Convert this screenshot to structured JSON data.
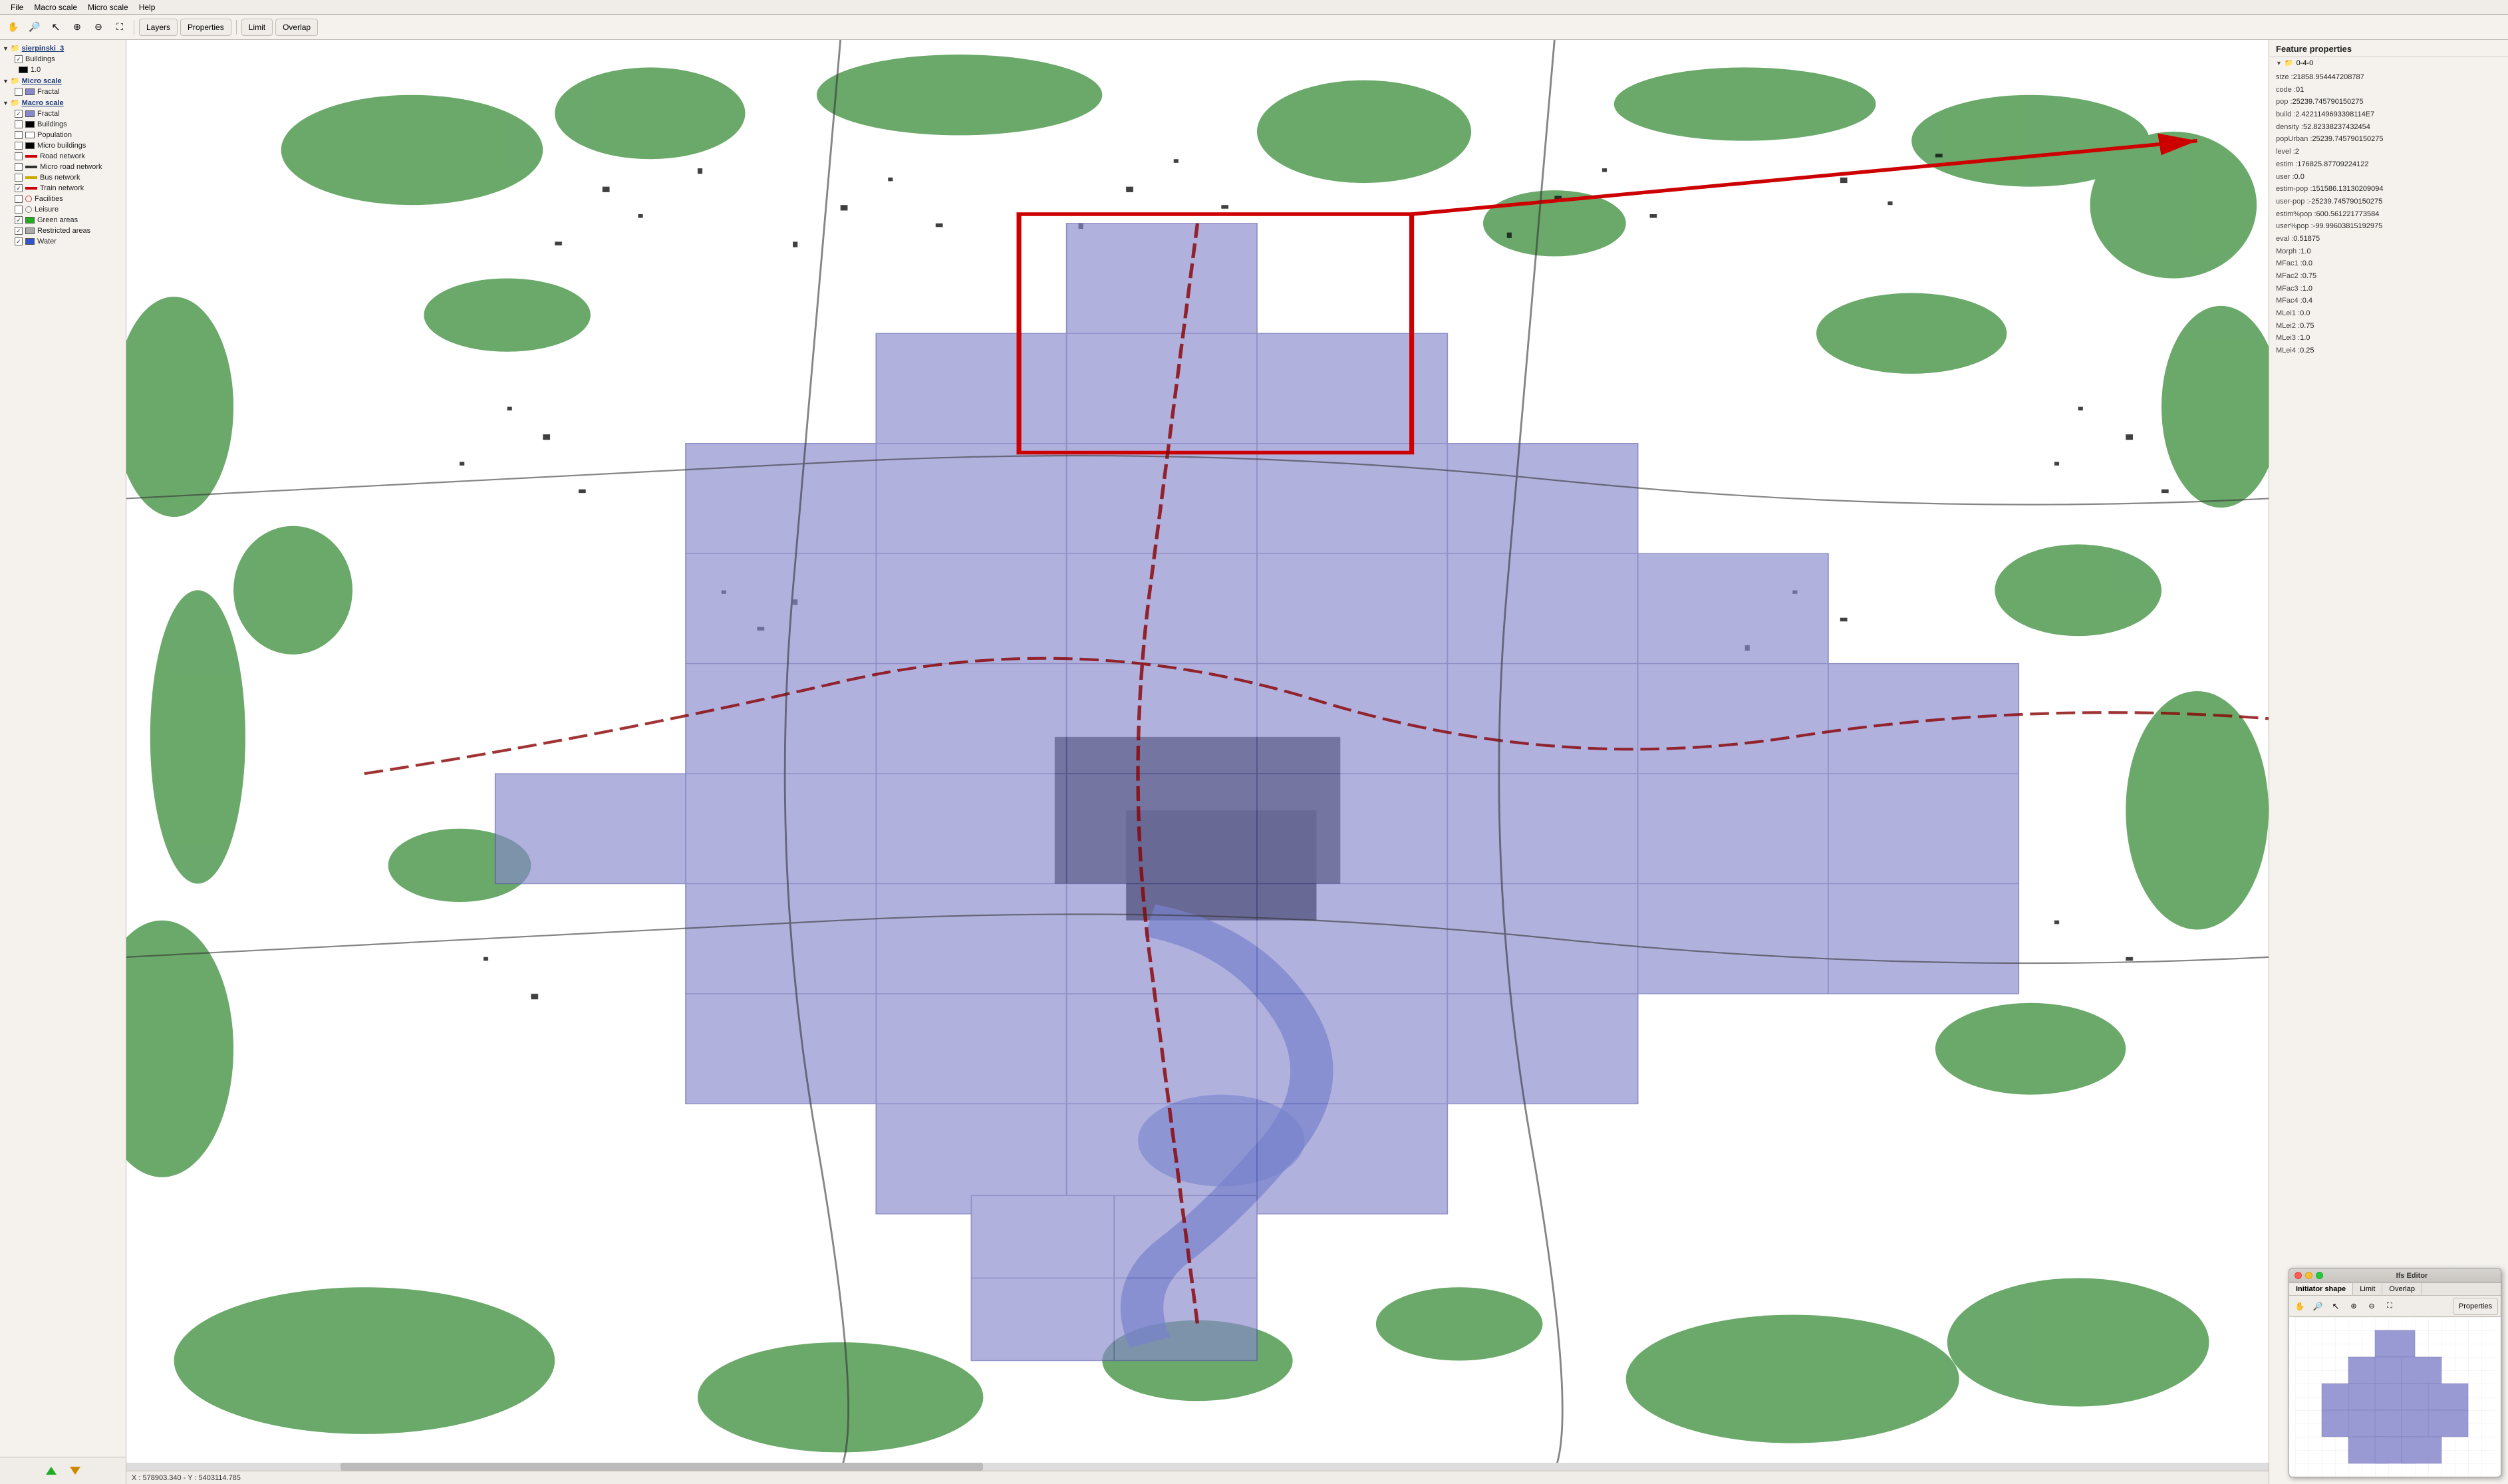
{
  "menubar": {
    "items": [
      "File",
      "Macro scale",
      "Micro scale",
      "Help"
    ]
  },
  "toolbar": {
    "buttons": [
      {
        "name": "hand-tool",
        "icon": "✋",
        "tooltip": "Pan"
      },
      {
        "name": "zoom-in",
        "icon": "🔍",
        "tooltip": "Zoom in"
      },
      {
        "name": "select",
        "icon": "↖",
        "tooltip": "Select"
      },
      {
        "name": "measure1",
        "icon": "⊕",
        "tooltip": "Measure 1"
      },
      {
        "name": "measure2",
        "icon": "⊖",
        "tooltip": "Measure 2"
      },
      {
        "name": "fullscreen",
        "icon": "⛶",
        "tooltip": "Fullscreen"
      }
    ],
    "text_buttons": [
      "Layers",
      "Properties",
      "Limit",
      "Overlap"
    ]
  },
  "sidebar": {
    "groups": [
      {
        "name": "sierpinski_3",
        "type": "root",
        "expanded": true,
        "items": [
          {
            "label": "Buildings",
            "checked": true,
            "swatch": "black",
            "swatch_value": "1.0"
          }
        ]
      },
      {
        "name": "Micro scale",
        "type": "group",
        "expanded": true,
        "items": [
          {
            "label": "Fractal",
            "checked": false,
            "color": "#8888cc"
          }
        ]
      },
      {
        "name": "Macro scale",
        "type": "group",
        "expanded": true,
        "items": [
          {
            "label": "Fractal",
            "checked": true,
            "color": "#8888cc"
          },
          {
            "label": "Buildings",
            "checked": false,
            "color": "#000000"
          },
          {
            "label": "Population",
            "checked": false,
            "color": "#ffffff"
          },
          {
            "label": "Micro buildings",
            "checked": false,
            "color": "#000000"
          },
          {
            "label": "Road network",
            "checked": false,
            "color": "#cc0000"
          },
          {
            "label": "Micro road network",
            "checked": false,
            "color": "#333333"
          },
          {
            "label": "Bus network",
            "checked": false,
            "color": "#ccaa00"
          },
          {
            "label": "Train network",
            "checked": true,
            "color": "#cc0000"
          },
          {
            "label": "Facilities",
            "checked": false,
            "color_circle": "#cc4444"
          },
          {
            "label": "Leisure",
            "checked": false,
            "color_circle": "#888888"
          },
          {
            "label": "Green areas",
            "checked": true,
            "color": "#22aa22"
          },
          {
            "label": "Restricted areas",
            "checked": true,
            "color": "#aaaaaa"
          },
          {
            "label": "Water",
            "checked": true,
            "color": "#3355cc"
          }
        ]
      }
    ],
    "footer": {
      "up_btn": "▲",
      "down_btn": "▼"
    }
  },
  "feature_properties": {
    "title": "Feature properties",
    "node": "0-4-0",
    "props": [
      {
        "key": "size",
        "value": "21858.954447208787"
      },
      {
        "key": "code",
        "value": "01"
      },
      {
        "key": "pop",
        "value": "25239.745790150275"
      },
      {
        "key": "build",
        "value": "2.4221149693398114E7"
      },
      {
        "key": "density",
        "value": "52.82338237432454"
      },
      {
        "key": "popUrban",
        "value": "25239.745790150275"
      },
      {
        "key": "level",
        "value": "2"
      },
      {
        "key": "estim",
        "value": "176825.87709224122"
      },
      {
        "key": "user",
        "value": "0.0"
      },
      {
        "key": "estim-pop",
        "value": "151586.13130209094"
      },
      {
        "key": "user-pop",
        "value": "-25239.745790150275"
      },
      {
        "key": "estim%pop",
        "value": "600.561221773584"
      },
      {
        "key": "user%pop",
        "value": "-99.99603815192975"
      },
      {
        "key": "eval",
        "value": "0.51875"
      },
      {
        "key": "Morph",
        "value": "1.0"
      },
      {
        "key": "MFac1",
        "value": "0.0"
      },
      {
        "key": "MFac2",
        "value": "0.75"
      },
      {
        "key": "MFac3",
        "value": "1.0"
      },
      {
        "key": "MFac4",
        "value": "0.4"
      },
      {
        "key": "MLei1",
        "value": "0.0"
      },
      {
        "key": "MLei2",
        "value": "0.75"
      },
      {
        "key": "MLei3",
        "value": "1.0"
      },
      {
        "key": "MLei4",
        "value": "0.25"
      }
    ]
  },
  "ifs_editor": {
    "title": "Ifs Editor",
    "tabs": [
      "Initiator shape",
      "Limit",
      "Overlap"
    ],
    "active_tab": "Initiator shape",
    "toolbar_buttons": [
      "✋",
      "🔍",
      "↖",
      "⊕",
      "⊖",
      "⛶"
    ],
    "properties_btn": "Properties"
  },
  "status_bar": {
    "text": "X : 578903.340 - Y : 5403114.785"
  },
  "colors": {
    "accent_blue": "#3d6bc4",
    "fractal_blue": "#8888cc",
    "green": "#22aa22",
    "water_blue": "#3355cc"
  }
}
